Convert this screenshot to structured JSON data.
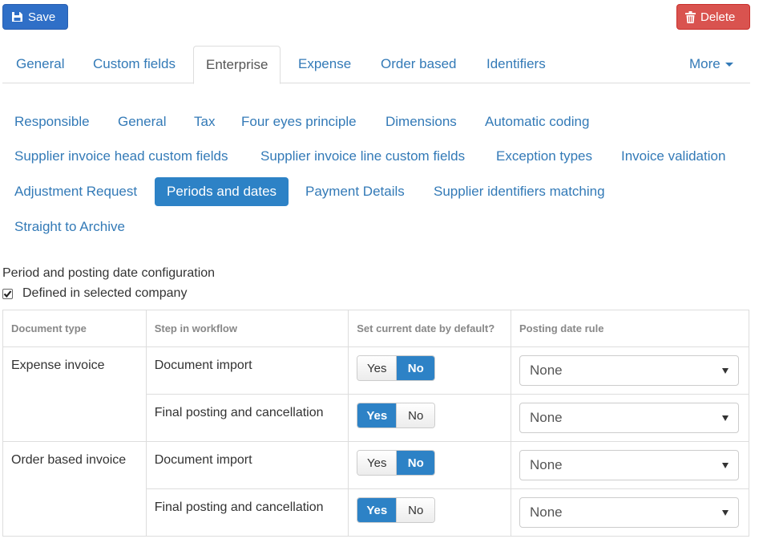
{
  "toolbar": {
    "save_label": "Save",
    "delete_label": "Delete"
  },
  "tabs": [
    {
      "label": "General"
    },
    {
      "label": "Custom fields"
    },
    {
      "label": "Enterprise"
    },
    {
      "label": "Expense"
    },
    {
      "label": "Order based"
    },
    {
      "label": "Identifiers"
    },
    {
      "label": "More"
    }
  ],
  "subnav": [
    {
      "label": "Responsible"
    },
    {
      "label": "General"
    },
    {
      "label": "Tax"
    },
    {
      "label": "Four eyes principle"
    },
    {
      "label": "Dimensions"
    },
    {
      "label": "Automatic coding"
    },
    {
      "label": "Supplier invoice head custom fields"
    },
    {
      "label": "Supplier invoice line custom fields"
    },
    {
      "label": "Exception types"
    },
    {
      "label": "Invoice validation"
    },
    {
      "label": "Adjustment Request"
    },
    {
      "label": "Periods and dates"
    },
    {
      "label": "Payment Details"
    },
    {
      "label": "Supplier identifiers matching"
    },
    {
      "label": "Straight to Archive"
    }
  ],
  "section": {
    "title": "Period and posting date configuration",
    "defined_label": "Defined in selected company",
    "defined_checked": true
  },
  "table": {
    "headers": [
      "Document type",
      "Step in workflow",
      "Set current date by default?",
      "Posting date rule"
    ],
    "toggle_labels": {
      "yes": "Yes",
      "no": "No"
    },
    "groups": [
      {
        "document_type": "Expense invoice",
        "steps": [
          {
            "step": "Document import",
            "current_date": "No",
            "rule": "None"
          },
          {
            "step": "Final posting and cancellation",
            "current_date": "Yes",
            "rule": "None"
          }
        ]
      },
      {
        "document_type": "Order based invoice",
        "steps": [
          {
            "step": "Document import",
            "current_date": "No",
            "rule": "None"
          },
          {
            "step": "Final posting and cancellation",
            "current_date": "Yes",
            "rule": "None"
          }
        ]
      }
    ]
  },
  "colors": {
    "primary": "#2d82c6",
    "link": "#337ab7",
    "danger": "#d9534f"
  }
}
